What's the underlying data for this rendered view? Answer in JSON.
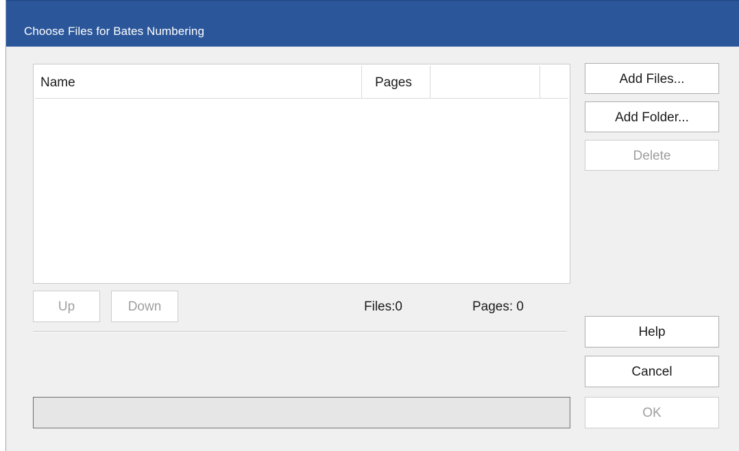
{
  "window": {
    "title": "Choose Files for Bates Numbering"
  },
  "file_list": {
    "columns": [
      "Name",
      "Pages",
      "",
      ""
    ],
    "rows": []
  },
  "buttons": {
    "add_files": "Add Files...",
    "add_folder": "Add Folder...",
    "delete": "Delete",
    "up": "Up",
    "down": "Down",
    "help": "Help",
    "cancel": "Cancel",
    "ok": "OK"
  },
  "status": {
    "files": "Files:0",
    "pages": "Pages: 0"
  },
  "progress": {
    "value": 0
  },
  "colors": {
    "titlebar": "#2b579a",
    "dialog_bg": "#f0f0f0",
    "disabled_text": "#9e9e9e"
  }
}
